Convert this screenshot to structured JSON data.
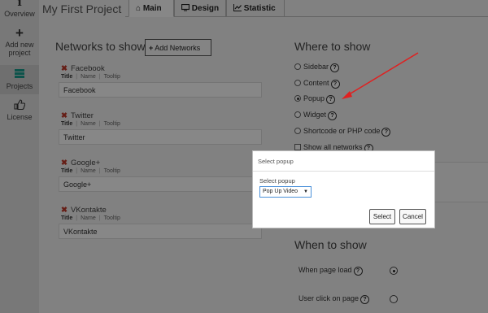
{
  "sidebar": {
    "items": [
      {
        "label": "Overview",
        "icon": "info-icon"
      },
      {
        "label": "Add new project",
        "icon": "plus-icon"
      },
      {
        "label": "Projects",
        "icon": "stack-icon"
      },
      {
        "label": "License",
        "icon": "thumb-up-icon"
      }
    ]
  },
  "header": {
    "project_title": "My First Project",
    "tabs": [
      {
        "label": "Main",
        "icon": "home-icon",
        "active": true
      },
      {
        "label": "Design",
        "icon": "monitor-icon",
        "active": false
      },
      {
        "label": "Statistic",
        "icon": "line-chart-icon",
        "active": false
      }
    ]
  },
  "networks": {
    "heading": "Networks to show",
    "add_button": "Add Networks",
    "subtab_labels": [
      "Title",
      "Name",
      "Tooltip"
    ],
    "items": [
      {
        "name": "Facebook",
        "value": "Facebook"
      },
      {
        "name": "Twitter",
        "value": "Twitter"
      },
      {
        "name": "Google+",
        "value": "Google+"
      },
      {
        "name": "VKontakte",
        "value": "VKontakte"
      }
    ]
  },
  "where": {
    "heading": "Where to show",
    "options": [
      {
        "label": "Sidebar",
        "selected": false
      },
      {
        "label": "Content",
        "selected": false
      },
      {
        "label": "Popup",
        "selected": true
      },
      {
        "label": "Widget",
        "selected": false
      },
      {
        "label": "Shortcode or PHP code",
        "selected": false
      }
    ],
    "show_all_label": "Show all networks"
  },
  "when": {
    "heading": "When to show",
    "options": [
      {
        "label": "When page load",
        "selected": true
      },
      {
        "label": "User click on page",
        "selected": false
      }
    ]
  },
  "modal": {
    "title": "Select popup",
    "field_label": "Select popup",
    "selected_value": "Pop Up Video",
    "select_button": "Select",
    "cancel_button": "Cancel"
  },
  "colors": {
    "delete_x": "#c0392b",
    "annotation_arrow": "#e02020",
    "select_focus": "#4a90d9"
  }
}
